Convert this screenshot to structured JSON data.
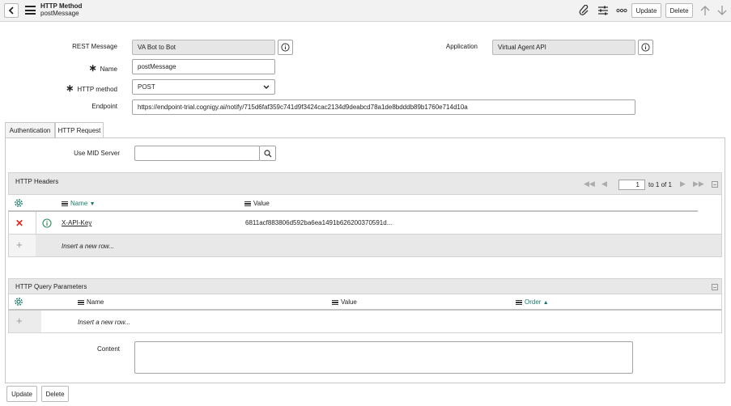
{
  "header": {
    "title": "HTTP Method",
    "subtitle": "postMessage",
    "update_label": "Update",
    "delete_label": "Delete"
  },
  "form": {
    "rest_message_label": "REST Message",
    "rest_message_value": "VA Bot to Bot",
    "application_label": "Application",
    "application_value": "Virtual Agent API",
    "name_label": "Name",
    "name_value": "postMessage",
    "http_method_label": "HTTP method",
    "http_method_value": "POST",
    "endpoint_label": "Endpoint",
    "endpoint_value": "https://endpoint-trial.cognigy.ai/notify/715d6faf359c741d9f3424cac2134d9deabcd78a1de8bdddb89b1760e714d10a"
  },
  "tabs": [
    {
      "label": "Authentication"
    },
    {
      "label": "HTTP Request"
    }
  ],
  "mid_server": {
    "label": "Use MID Server",
    "value": ""
  },
  "headers_list": {
    "title": "HTTP Headers",
    "page_value": "1",
    "page_suffix": "to 1 of 1",
    "columns": [
      "Name",
      "Value"
    ],
    "rows": [
      {
        "name": "X-API-Key",
        "value": "6811acf883806d592ba6ea1491b626200370591d..."
      }
    ],
    "insert_label": "Insert a new row..."
  },
  "query_list": {
    "title": "HTTP Query Parameters",
    "columns": [
      "Name",
      "Value",
      "Order"
    ],
    "insert_label": "Insert a new row..."
  },
  "content": {
    "label": "Content",
    "value": ""
  },
  "footer": {
    "update_label": "Update",
    "delete_label": "Delete"
  },
  "colors": {
    "link": "#1a7a6b",
    "delete_x": "#e0281c",
    "info_green": "#2b8a5c"
  }
}
